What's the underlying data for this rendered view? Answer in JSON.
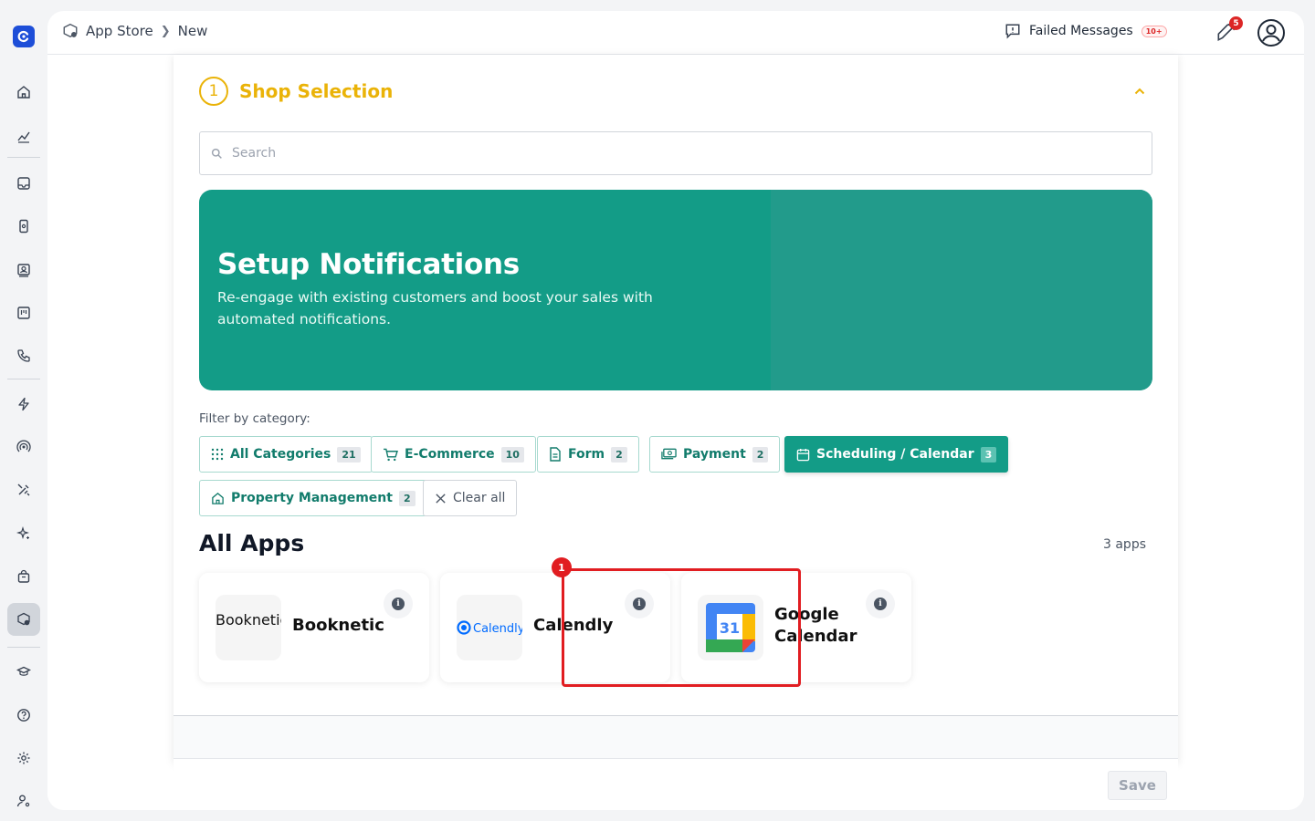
{
  "breadcrumb": {
    "root": "App Store",
    "current": "New"
  },
  "header": {
    "failed_label": "Failed Messages",
    "failed_count": "10+",
    "notification_count": "5"
  },
  "step": {
    "number": "1",
    "title": "Shop Selection"
  },
  "search": {
    "placeholder": "Search",
    "value": ""
  },
  "banner": {
    "title": "Setup Notifications",
    "subtitle": "Re-engage with existing customers and boost your sales with automated notifications."
  },
  "filters": {
    "label": "Filter by category:",
    "chips": [
      {
        "label": "All Categories",
        "count": "21",
        "icon": "grid-icon"
      },
      {
        "label": "E-Commerce",
        "count": "10",
        "icon": "cart-icon"
      },
      {
        "label": "Form",
        "count": "2",
        "icon": "document-icon"
      },
      {
        "label": "Payment",
        "count": "2",
        "icon": "money-icon"
      },
      {
        "label": "Scheduling / Calendar",
        "count": "3",
        "icon": "calendar-icon",
        "selected": true
      },
      {
        "label": "Property Management",
        "count": "2",
        "icon": "house-icon"
      }
    ],
    "clear_label": "Clear all"
  },
  "apps": {
    "title": "All Apps",
    "count_label": "3 apps",
    "items": [
      {
        "name": "Booknetic",
        "logo_alt": "Booknetic"
      },
      {
        "name": "Calendly",
        "logo_text": "Calendly"
      },
      {
        "name_line1": "Google",
        "name_line2": "Calendar",
        "logo_text": "31"
      }
    ]
  },
  "highlight": {
    "badge": "1"
  },
  "footer": {
    "save_label": "Save"
  },
  "colors": {
    "primary": "#139c87",
    "step": "#eab308",
    "highlight": "#e11d21",
    "logo": "#1d4ed8"
  }
}
